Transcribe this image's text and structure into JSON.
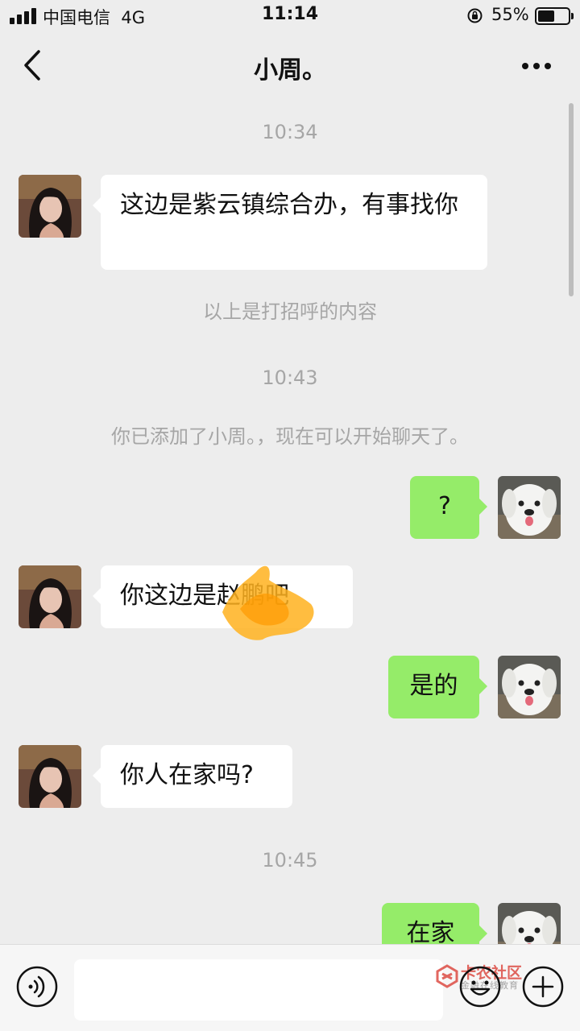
{
  "status_bar": {
    "carrier": "中国电信",
    "network": "4G",
    "time": "11:14",
    "battery_percent": "55%",
    "battery_level": 0.55,
    "lock_icon": "orientation-lock-icon",
    "signal_icon": "cellular-signal-icon"
  },
  "nav": {
    "back_icon": "chevron-left-icon",
    "title": "小周。",
    "more_icon": "more-dots-icon"
  },
  "chat": {
    "timestamps": [
      "10:34",
      "10:43",
      "10:45"
    ],
    "system_messages": [
      "以上是打招呼的内容",
      "你已添加了小周。，现在可以开始聊天了。"
    ],
    "messages": [
      {
        "from": "contact",
        "text": "这边是紫云镇综合办，有事找你"
      },
      {
        "from": "me",
        "text": "?"
      },
      {
        "from": "contact",
        "text": "你这边是赵鹏吧"
      },
      {
        "from": "me",
        "text": "是的"
      },
      {
        "from": "contact",
        "text": "你人在家吗?"
      },
      {
        "from": "me",
        "text": "在家"
      }
    ]
  },
  "input_bar": {
    "voice_icon": "voice-input-icon",
    "text_value": "",
    "emoji_icon": "emoji-icon",
    "plus_icon": "plus-icon",
    "watermark_text": "卡农社区",
    "watermark_sub": "金融在线教育"
  },
  "colors": {
    "background": "#ededed",
    "outgoing_bubble": "#95ec69",
    "incoming_bubble": "#ffffff",
    "muted_text": "#a6a6a6"
  }
}
